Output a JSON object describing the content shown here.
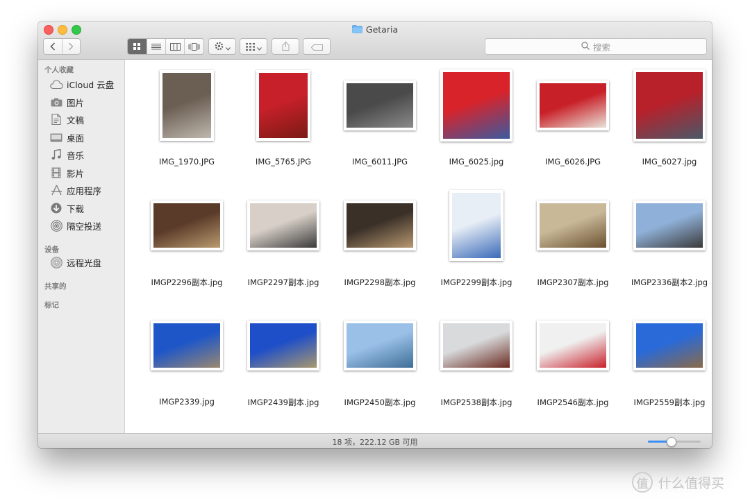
{
  "window": {
    "title": "Getaria"
  },
  "toolbar": {
    "search_placeholder": "搜索",
    "view_modes": [
      "icon-view",
      "list-view",
      "column-view",
      "cover-flow-view"
    ],
    "active_view": "icon-view"
  },
  "sidebar": {
    "sections": [
      {
        "title": "个人收藏",
        "items": [
          {
            "label": "iCloud 云盘",
            "icon": "cloud-icon"
          },
          {
            "label": "图片",
            "icon": "camera-icon"
          },
          {
            "label": "文稿",
            "icon": "document-icon"
          },
          {
            "label": "桌面",
            "icon": "desktop-icon"
          },
          {
            "label": "音乐",
            "icon": "music-icon"
          },
          {
            "label": "影片",
            "icon": "film-icon"
          },
          {
            "label": "应用程序",
            "icon": "applications-icon"
          },
          {
            "label": "下载",
            "icon": "download-icon"
          },
          {
            "label": "隔空投送",
            "icon": "airdrop-icon"
          }
        ]
      },
      {
        "title": "设备",
        "items": [
          {
            "label": "远程光盘",
            "icon": "disc-icon"
          }
        ]
      },
      {
        "title": "共享的",
        "items": []
      },
      {
        "title": "标记",
        "items": []
      }
    ]
  },
  "files": [
    {
      "name": "IMG_1970.JPG",
      "orientation": "portrait",
      "colors": [
        "#6b5e52",
        "#bfb8ae"
      ]
    },
    {
      "name": "IMG_5765.JPG",
      "orientation": "portrait",
      "colors": [
        "#c8202a",
        "#7a1a14"
      ]
    },
    {
      "name": "IMG_6011.JPG",
      "orientation": "landscape",
      "colors": [
        "#4a4a4a",
        "#8a8a8a"
      ]
    },
    {
      "name": "IMG_6025.jpg",
      "orientation": "square",
      "colors": [
        "#d8232a",
        "#3a5aa0"
      ]
    },
    {
      "name": "IMG_6026.JPG",
      "orientation": "landscape",
      "colors": [
        "#c82028",
        "#e8e2d8"
      ]
    },
    {
      "name": "IMG_6027.jpg",
      "orientation": "square",
      "colors": [
        "#b8202a",
        "#4a5868"
      ]
    },
    {
      "name": "IMGP2296副本.jpg",
      "orientation": "landscape",
      "colors": [
        "#5a3a28",
        "#b89a70"
      ]
    },
    {
      "name": "IMGP2297副本.jpg",
      "orientation": "landscape",
      "colors": [
        "#d8d0c8",
        "#3a3a3a"
      ]
    },
    {
      "name": "IMGP2298副本.jpg",
      "orientation": "landscape",
      "colors": [
        "#3a3028",
        "#b89870"
      ]
    },
    {
      "name": "IMGP2299副本.jpg",
      "orientation": "portrait",
      "colors": [
        "#e8eef6",
        "#3a6ab8"
      ]
    },
    {
      "name": "IMGP2307副本.jpg",
      "orientation": "landscape",
      "colors": [
        "#c8b898",
        "#6a5030"
      ]
    },
    {
      "name": "IMGP2336副本2.jpg",
      "orientation": "landscape",
      "colors": [
        "#8fb0d8",
        "#3a3a3a"
      ]
    },
    {
      "name": "IMGP2339.jpg",
      "orientation": "landscape",
      "colors": [
        "#1e56c8",
        "#9a8870"
      ]
    },
    {
      "name": "IMGP2439副本.jpg",
      "orientation": "landscape",
      "colors": [
        "#1e4ec8",
        "#a8986e"
      ]
    },
    {
      "name": "IMGP2450副本.jpg",
      "orientation": "landscape",
      "colors": [
        "#9ac0e8",
        "#3e6e96"
      ]
    },
    {
      "name": "IMGP2538副本.jpg",
      "orientation": "landscape",
      "colors": [
        "#d8dadc",
        "#6a2a20"
      ]
    },
    {
      "name": "IMGP2546副本.jpg",
      "orientation": "landscape",
      "colors": [
        "#f0f0f0",
        "#c8202a"
      ]
    },
    {
      "name": "IMGP2559副本.jpg",
      "orientation": "landscape",
      "colors": [
        "#2a6ad8",
        "#8a6a48"
      ]
    }
  ],
  "status": {
    "text": "18 项，222.12 GB 可用",
    "zoom_level": 0.45
  },
  "watermark": {
    "badge": "值",
    "text": "什么值得买"
  }
}
